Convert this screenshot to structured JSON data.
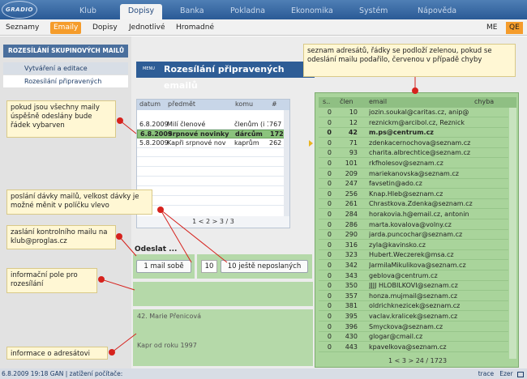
{
  "logo": "GRADIO PROGLAS",
  "nav": [
    "Klub",
    "Dopisy",
    "Banka",
    "Pokladna",
    "Ekonomika",
    "Systém",
    "Nápověda"
  ],
  "subnav": {
    "items": [
      "Seznamy",
      "Emaily",
      "Dopisy",
      "Jednotlivé",
      "Hromadné"
    ],
    "right": [
      "ME",
      "QE"
    ]
  },
  "sidebar": {
    "title": "ROZESÍLÁNÍ SKUPINOVÝCH MAILŮ",
    "items": [
      "Vytváření a editace",
      "Rozesílání připravených"
    ]
  },
  "page": {
    "menu_tag": "MENU",
    "title": "Rozesílání připravených emailů"
  },
  "left_table": {
    "headers": [
      "datum",
      "předmět",
      "komu",
      "#"
    ],
    "rows": [
      [
        "6.8.2009",
        "Milí členové",
        "členům (i 17",
        "767"
      ],
      [
        "6.8.2009",
        "Srpnové novinky",
        "dárcům",
        "1723"
      ],
      [
        "5.8.2009",
        "Kapři srpnové nov",
        "kaprům",
        "262"
      ]
    ],
    "pager": "1 < 2 > 3 / 3"
  },
  "send": {
    "label": "Odeslat ...",
    "self_button": "1 mail sobě",
    "batch_value": "10",
    "remaining_button": "10 ještě neposlaných"
  },
  "address": {
    "name": "42. Marie Přenicová",
    "line2": "Kapr od roku 1997"
  },
  "right_table": {
    "headers": [
      "s..",
      "člen",
      "email",
      "chyba"
    ],
    "rows": [
      [
        "0",
        "10",
        "jozin.soukal@caritas.cz, anip@"
      ],
      [
        "0",
        "12",
        "reznickm@arcibol.cz, Reznick"
      ],
      [
        "0",
        "42",
        "m.ps@centrum.cz"
      ],
      [
        "0",
        "71",
        "zdenkacernochova@seznam.cz"
      ],
      [
        "0",
        "93",
        "charita.albrechtice@seznam.cz"
      ],
      [
        "0",
        "101",
        "rkfholesov@seznam.cz"
      ],
      [
        "0",
        "209",
        "mariekanovska@seznam.cz"
      ],
      [
        "0",
        "247",
        "favsetin@ado.cz"
      ],
      [
        "0",
        "256",
        "Knap.Hleb@seznam.cz"
      ],
      [
        "0",
        "261",
        "Chrastkova.Zdenka@seznam.cz"
      ],
      [
        "0",
        "284",
        "horakovia.h@email.cz, antonin"
      ],
      [
        "0",
        "286",
        "marta.kovalova@volny.cz"
      ],
      [
        "0",
        "290",
        "jarda.puncochar@seznam.cz"
      ],
      [
        "0",
        "316",
        "zyla@kavinsko.cz"
      ],
      [
        "0",
        "323",
        "Hubert.Weczerek@msa.cz"
      ],
      [
        "0",
        "342",
        "JarmilaMikulikova@seznam.cz"
      ],
      [
        "0",
        "343",
        "geblova@centrum.cz"
      ],
      [
        "0",
        "350",
        "JJJJ HLOBILKOVI@seznam.cz"
      ],
      [
        "0",
        "357",
        "honza.mujmail@seznam.cz"
      ],
      [
        "0",
        "381",
        "oldrichknezicek@seznam.cz"
      ],
      [
        "0",
        "395",
        "vaclav.kralicek@seznam.cz"
      ],
      [
        "0",
        "396",
        "Smyckova@seznam.cz"
      ],
      [
        "0",
        "430",
        "glogar@cmail.cz"
      ],
      [
        "0",
        "443",
        "kpavelkova@seznam.cz"
      ]
    ],
    "current_row": 2,
    "pager": "1 < 3 > 24 / 1723"
  },
  "callouts": {
    "top_right": "seznam adresátů, řádky se podloží zelenou, pokud se odeslání mailu podařilo, červenou v případě chyby",
    "selected_row": "pokud jsou všechny maily úspěšně odeslány bude řádek vybarven",
    "batch": "poslání dávky mailů, velkost dávky je možné měnit v políčku vlevo",
    "control": "zaslání kontrolního mailu na klub@proglas.cz",
    "info": "informační pole pro rozesílání",
    "recipient": "informace o adresátovi"
  },
  "status": {
    "left": "6.8.2009 19:18   GAN  | zatížení počítače:",
    "right_trace": "trace",
    "right_ezer": "Ezer"
  },
  "colors": {
    "accent": "#f59c2b",
    "nav": "#2a5a96",
    "panel_green": "#b5d9a9",
    "marker": "#d6221d"
  }
}
